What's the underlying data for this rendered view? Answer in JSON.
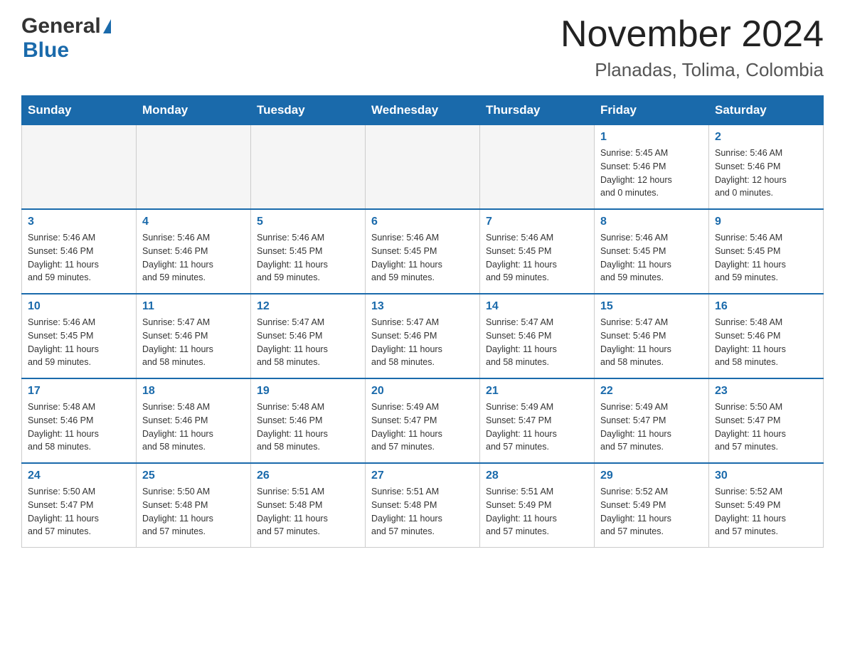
{
  "logo": {
    "general": "General",
    "blue": "Blue"
  },
  "title": "November 2024",
  "subtitle": "Planadas, Tolima, Colombia",
  "weekdays": [
    "Sunday",
    "Monday",
    "Tuesday",
    "Wednesday",
    "Thursday",
    "Friday",
    "Saturday"
  ],
  "weeks": [
    [
      {
        "day": "",
        "info": ""
      },
      {
        "day": "",
        "info": ""
      },
      {
        "day": "",
        "info": ""
      },
      {
        "day": "",
        "info": ""
      },
      {
        "day": "",
        "info": ""
      },
      {
        "day": "1",
        "info": "Sunrise: 5:45 AM\nSunset: 5:46 PM\nDaylight: 12 hours\nand 0 minutes."
      },
      {
        "day": "2",
        "info": "Sunrise: 5:46 AM\nSunset: 5:46 PM\nDaylight: 12 hours\nand 0 minutes."
      }
    ],
    [
      {
        "day": "3",
        "info": "Sunrise: 5:46 AM\nSunset: 5:46 PM\nDaylight: 11 hours\nand 59 minutes."
      },
      {
        "day": "4",
        "info": "Sunrise: 5:46 AM\nSunset: 5:46 PM\nDaylight: 11 hours\nand 59 minutes."
      },
      {
        "day": "5",
        "info": "Sunrise: 5:46 AM\nSunset: 5:45 PM\nDaylight: 11 hours\nand 59 minutes."
      },
      {
        "day": "6",
        "info": "Sunrise: 5:46 AM\nSunset: 5:45 PM\nDaylight: 11 hours\nand 59 minutes."
      },
      {
        "day": "7",
        "info": "Sunrise: 5:46 AM\nSunset: 5:45 PM\nDaylight: 11 hours\nand 59 minutes."
      },
      {
        "day": "8",
        "info": "Sunrise: 5:46 AM\nSunset: 5:45 PM\nDaylight: 11 hours\nand 59 minutes."
      },
      {
        "day": "9",
        "info": "Sunrise: 5:46 AM\nSunset: 5:45 PM\nDaylight: 11 hours\nand 59 minutes."
      }
    ],
    [
      {
        "day": "10",
        "info": "Sunrise: 5:46 AM\nSunset: 5:45 PM\nDaylight: 11 hours\nand 59 minutes."
      },
      {
        "day": "11",
        "info": "Sunrise: 5:47 AM\nSunset: 5:46 PM\nDaylight: 11 hours\nand 58 minutes."
      },
      {
        "day": "12",
        "info": "Sunrise: 5:47 AM\nSunset: 5:46 PM\nDaylight: 11 hours\nand 58 minutes."
      },
      {
        "day": "13",
        "info": "Sunrise: 5:47 AM\nSunset: 5:46 PM\nDaylight: 11 hours\nand 58 minutes."
      },
      {
        "day": "14",
        "info": "Sunrise: 5:47 AM\nSunset: 5:46 PM\nDaylight: 11 hours\nand 58 minutes."
      },
      {
        "day": "15",
        "info": "Sunrise: 5:47 AM\nSunset: 5:46 PM\nDaylight: 11 hours\nand 58 minutes."
      },
      {
        "day": "16",
        "info": "Sunrise: 5:48 AM\nSunset: 5:46 PM\nDaylight: 11 hours\nand 58 minutes."
      }
    ],
    [
      {
        "day": "17",
        "info": "Sunrise: 5:48 AM\nSunset: 5:46 PM\nDaylight: 11 hours\nand 58 minutes."
      },
      {
        "day": "18",
        "info": "Sunrise: 5:48 AM\nSunset: 5:46 PM\nDaylight: 11 hours\nand 58 minutes."
      },
      {
        "day": "19",
        "info": "Sunrise: 5:48 AM\nSunset: 5:46 PM\nDaylight: 11 hours\nand 58 minutes."
      },
      {
        "day": "20",
        "info": "Sunrise: 5:49 AM\nSunset: 5:47 PM\nDaylight: 11 hours\nand 57 minutes."
      },
      {
        "day": "21",
        "info": "Sunrise: 5:49 AM\nSunset: 5:47 PM\nDaylight: 11 hours\nand 57 minutes."
      },
      {
        "day": "22",
        "info": "Sunrise: 5:49 AM\nSunset: 5:47 PM\nDaylight: 11 hours\nand 57 minutes."
      },
      {
        "day": "23",
        "info": "Sunrise: 5:50 AM\nSunset: 5:47 PM\nDaylight: 11 hours\nand 57 minutes."
      }
    ],
    [
      {
        "day": "24",
        "info": "Sunrise: 5:50 AM\nSunset: 5:47 PM\nDaylight: 11 hours\nand 57 minutes."
      },
      {
        "day": "25",
        "info": "Sunrise: 5:50 AM\nSunset: 5:48 PM\nDaylight: 11 hours\nand 57 minutes."
      },
      {
        "day": "26",
        "info": "Sunrise: 5:51 AM\nSunset: 5:48 PM\nDaylight: 11 hours\nand 57 minutes."
      },
      {
        "day": "27",
        "info": "Sunrise: 5:51 AM\nSunset: 5:48 PM\nDaylight: 11 hours\nand 57 minutes."
      },
      {
        "day": "28",
        "info": "Sunrise: 5:51 AM\nSunset: 5:49 PM\nDaylight: 11 hours\nand 57 minutes."
      },
      {
        "day": "29",
        "info": "Sunrise: 5:52 AM\nSunset: 5:49 PM\nDaylight: 11 hours\nand 57 minutes."
      },
      {
        "day": "30",
        "info": "Sunrise: 5:52 AM\nSunset: 5:49 PM\nDaylight: 11 hours\nand 57 minutes."
      }
    ]
  ]
}
